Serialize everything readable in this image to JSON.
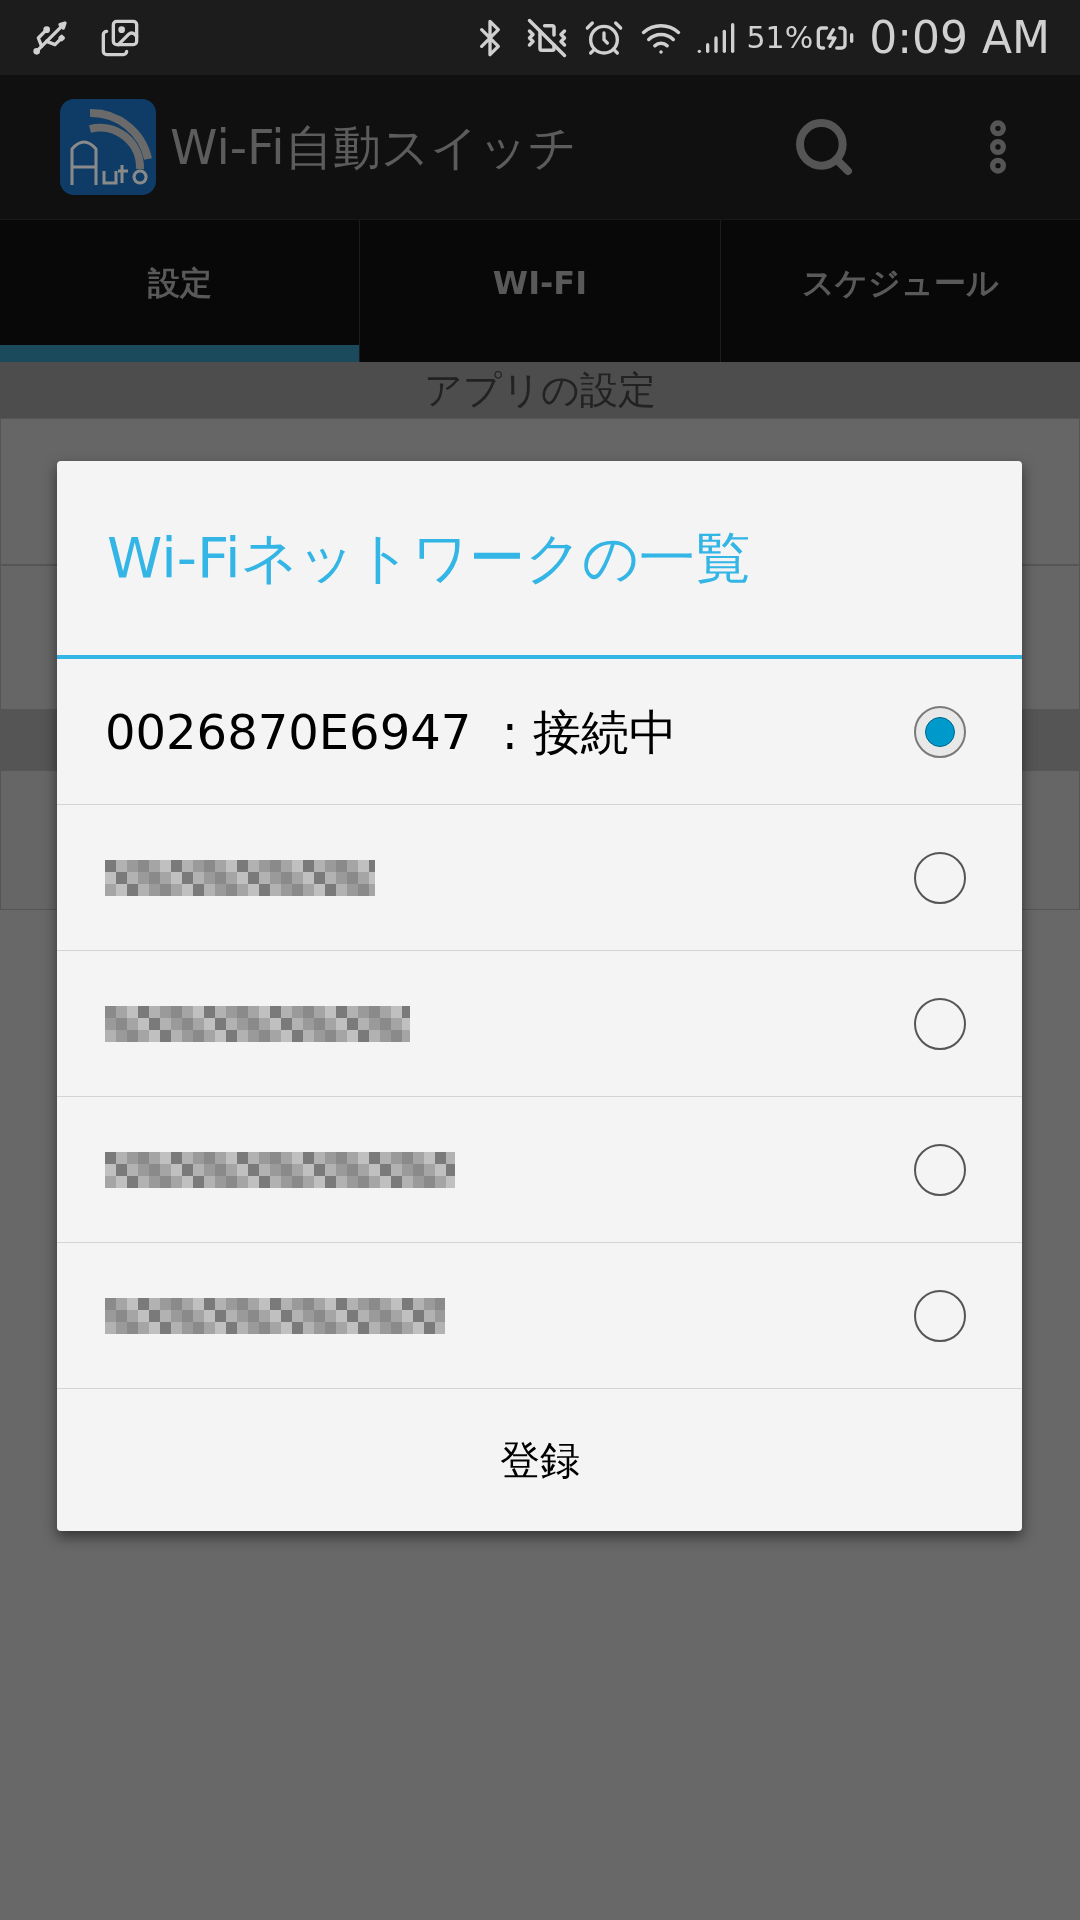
{
  "status_bar": {
    "battery": "51%",
    "time": "0:09 AM"
  },
  "app_bar": {
    "title": "Wi-Fi自動スイッチ"
  },
  "tabs": [
    {
      "label": "設定",
      "selected": true
    },
    {
      "label": "WI-FI",
      "selected": false
    },
    {
      "label": "スケジュール",
      "selected": false
    }
  ],
  "section_header": "アプリの設定",
  "dialog": {
    "title": "Wi-Fiネットワークの一覧",
    "networks": [
      {
        "kind": "named",
        "label": "0026870E6947  : 接続中",
        "selected": true
      },
      {
        "kind": "redacted",
        "selected": false
      },
      {
        "kind": "redacted",
        "selected": false
      },
      {
        "kind": "redacted",
        "selected": false
      },
      {
        "kind": "redacted",
        "selected": false
      }
    ],
    "button": "登録"
  }
}
